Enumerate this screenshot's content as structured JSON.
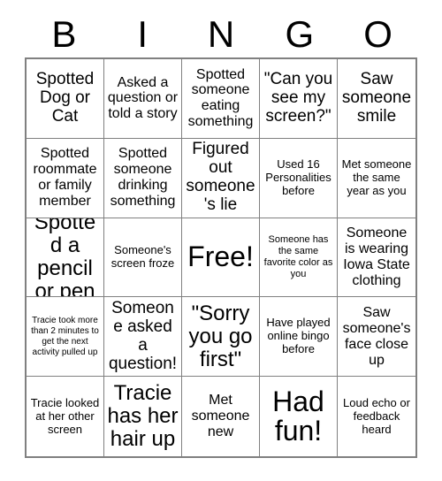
{
  "card": {
    "header_letters": [
      "B",
      "I",
      "N",
      "G",
      "O"
    ],
    "columns": 5,
    "rows": 5,
    "border_color": "#808080",
    "background_color": "#ffffff",
    "text_color": "#000000",
    "free_space_index": 12,
    "cells": [
      {
        "text": "Spotted Dog or Cat",
        "size": "lg"
      },
      {
        "text": "Asked a question or told a story",
        "size": "md"
      },
      {
        "text": "Spotted someone eating something",
        "size": "md"
      },
      {
        "text": "\"Can you see my screen?\"",
        "size": "lg"
      },
      {
        "text": "Saw someone smile",
        "size": "lg"
      },
      {
        "text": "Spotted roommate or family member",
        "size": "md"
      },
      {
        "text": "Spotted someone drinking something",
        "size": "md"
      },
      {
        "text": "Figured out someone's lie",
        "size": "lg"
      },
      {
        "text": "Used 16 Personalities before",
        "size": "sm"
      },
      {
        "text": "Met someone the same year as you",
        "size": "sm"
      },
      {
        "text": "Spotted a pencil or pen",
        "size": "xl"
      },
      {
        "text": "Someone's screen froze",
        "size": "sm"
      },
      {
        "text": "Free!",
        "size": "xxl"
      },
      {
        "text": "Someone has the same favorite color as you",
        "size": "xs"
      },
      {
        "text": "Someone is wearing Iowa State clothing",
        "size": "md"
      },
      {
        "text": "Tracie took more than 2 minutes to get the next activity pulled up",
        "size": "xxs"
      },
      {
        "text": "Someone asked a question!",
        "size": "lg"
      },
      {
        "text": "\"Sorry you go first\"",
        "size": "xl"
      },
      {
        "text": "Have played online bingo before",
        "size": "sm"
      },
      {
        "text": "Saw someone's face close up",
        "size": "md"
      },
      {
        "text": "Tracie looked at her other screen",
        "size": "sm"
      },
      {
        "text": "Tracie has her hair up",
        "size": "xl"
      },
      {
        "text": "Met someone new",
        "size": "md"
      },
      {
        "text": "Had fun!",
        "size": "xxl"
      },
      {
        "text": "Loud echo or feedback heard",
        "size": "sm"
      }
    ]
  }
}
